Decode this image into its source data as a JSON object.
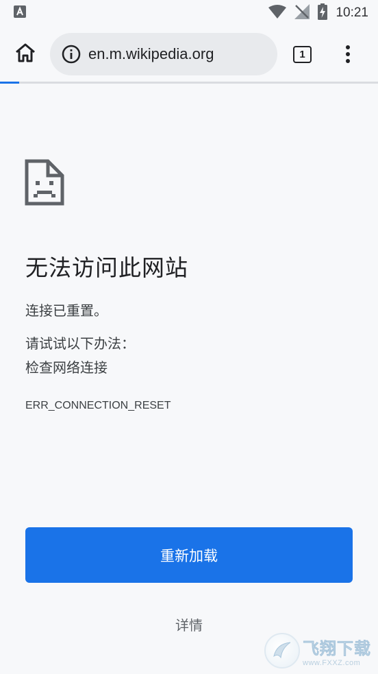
{
  "status_bar": {
    "time": "10:21",
    "notification_icon": "a-box-icon",
    "wifi_icon": "wifi-icon",
    "signal_icon": "no-signal-icon",
    "battery_icon": "battery-charging-icon"
  },
  "toolbar": {
    "url": "en.m.wikipedia.org",
    "tab_count": "1",
    "home_icon": "home-icon",
    "info_icon": "info-icon",
    "menu_icon": "more-vert-icon"
  },
  "error": {
    "icon": "sad-page-icon",
    "title": "无法访问此网站",
    "message": "连接已重置。",
    "suggestions_heading": "请试试以下办法：",
    "suggestion_1": "检查网络连接",
    "code": "ERR_CONNECTION_RESET"
  },
  "actions": {
    "reload_label": "重新加载",
    "details_label": "详情"
  },
  "watermark": {
    "cn": "飞翔下载",
    "en": "www.FXXZ.com"
  },
  "colors": {
    "accent": "#1a73e8",
    "background": "#f7f8fa",
    "omnibox": "#e8eaed"
  }
}
